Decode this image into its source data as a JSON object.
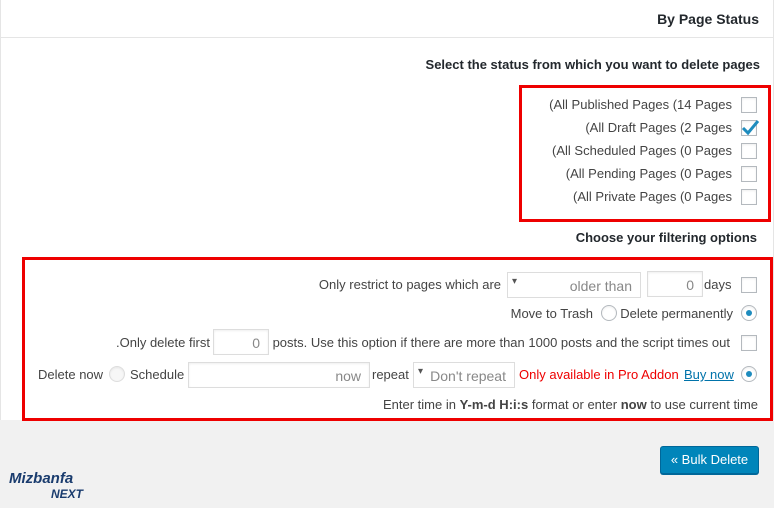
{
  "header": {
    "title": "By Page Status"
  },
  "status_section": {
    "heading": "Select the status from which you want to delete pages",
    "items": [
      {
        "label": "(All Published Pages (14 Pages",
        "checked": false
      },
      {
        "label": "(All Draft Pages (2 Pages",
        "checked": true
      },
      {
        "label": "(All Scheduled Pages (0 Pages",
        "checked": false
      },
      {
        "label": "(All Pending Pages (0 Pages",
        "checked": false
      },
      {
        "label": "(All Private Pages (0 Pages",
        "checked": false
      }
    ]
  },
  "filter_section": {
    "heading": "Choose your filtering options",
    "restrict": {
      "label": "Only restrict to pages which are",
      "select_value": "older than",
      "days_value": "0",
      "days_label": "days",
      "checked": false
    },
    "trash": {
      "move_label": "Move to Trash",
      "delete_label": "Delete permanently",
      "selected": "delete"
    },
    "limit": {
      "prefix": ".Only delete first",
      "value": "0",
      "suffix": "posts. Use this option if there are more than 1000 posts and the script times out",
      "checked": false
    },
    "schedule": {
      "delete_now_label": "Delete now",
      "schedule_label": "Schedule",
      "time_placeholder": "now",
      "repeat_label": "repeat",
      "repeat_value": "Don't repeat",
      "pro_text": "Only available in Pro Addon",
      "buy_link": "Buy now",
      "selected": "delete_now"
    },
    "hint": {
      "pre": "Enter time in",
      "format": "Y-m-d H:i:s",
      "mid": "format or enter",
      "now": "now",
      "post": "to use current time"
    }
  },
  "actions": {
    "bulk_delete_label": "« Bulk Delete"
  },
  "logo": {
    "top": "Mizbanfa",
    "bottom": "NEXT"
  },
  "colors": {
    "primary_button": "#0085ba",
    "highlight_border": "#e00000",
    "radio_dot": "#1e8cbe"
  }
}
